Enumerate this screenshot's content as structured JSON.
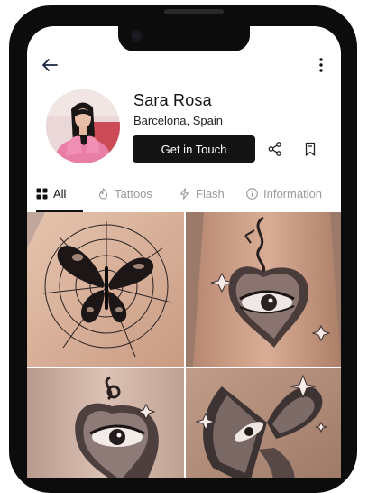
{
  "profile": {
    "name": "Sara Rosa",
    "location": "Barcelona, Spain",
    "cta_label": "Get in Touch"
  },
  "tabs": [
    {
      "label": "All",
      "icon": "grid-icon",
      "active": true
    },
    {
      "label": "Tattoos",
      "icon": "flame-icon",
      "active": false
    },
    {
      "label": "Flash",
      "icon": "bolt-icon",
      "active": false
    },
    {
      "label": "Information",
      "icon": "info-icon",
      "active": false
    }
  ],
  "gallery": [
    {
      "subject": "butterfly-spiderweb-tattoo"
    },
    {
      "subject": "heart-eye-tattoo"
    },
    {
      "subject": "heart-eye-lock-tattoo"
    },
    {
      "subject": "butterfly-face-sparkle-tattoo"
    }
  ],
  "colors": {
    "accent": "#141414",
    "tab_inactive": "#9a9a9a",
    "skin": "#d8b39d"
  }
}
